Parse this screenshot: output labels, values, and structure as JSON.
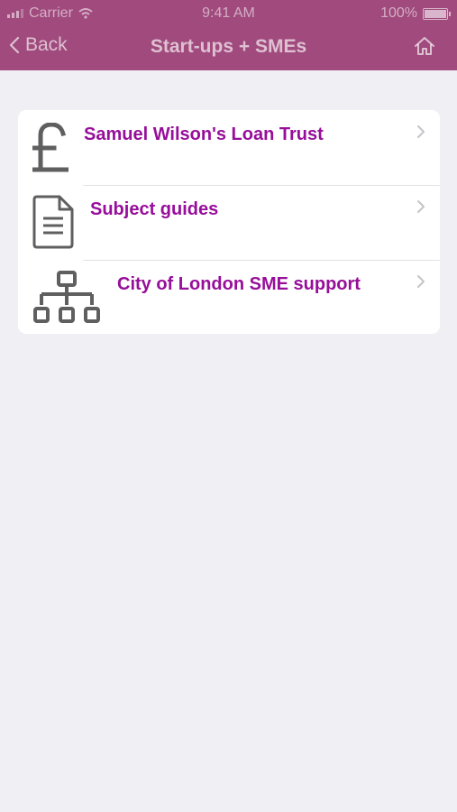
{
  "status_bar": {
    "carrier": "Carrier",
    "time": "9:41 AM",
    "battery": "100%"
  },
  "nav": {
    "back_label": "Back",
    "title": "Start-ups + SMEs"
  },
  "list": {
    "items": [
      {
        "label": "Samuel Wilson's Loan Trust",
        "icon": "pound-sterling-icon"
      },
      {
        "label": "Subject guides",
        "icon": "document-icon"
      },
      {
        "label": "City of London SME support",
        "icon": "org-chart-icon"
      }
    ]
  },
  "colors": {
    "nav_bar": "#a04a7d",
    "item_text": "#970e9a",
    "background": "#efeff4",
    "icon": "#5f5f5f"
  }
}
